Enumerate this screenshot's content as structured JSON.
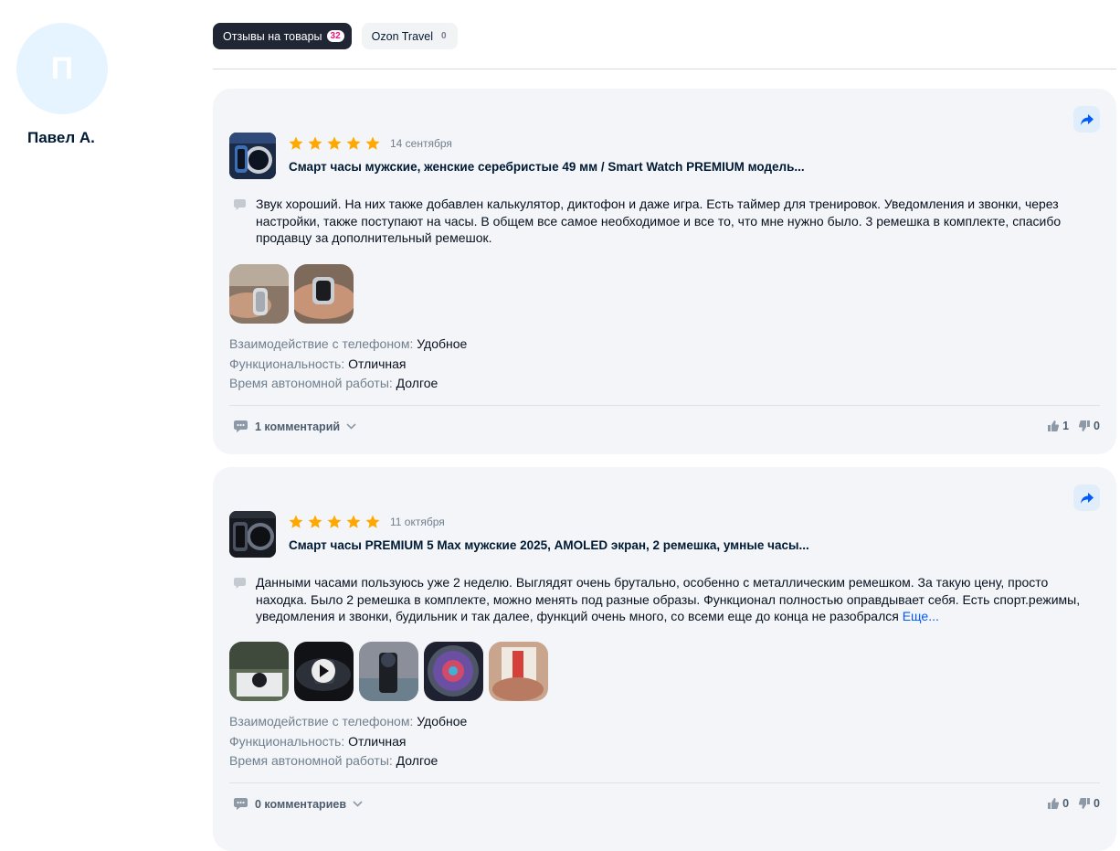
{
  "profile": {
    "initial": "П",
    "name": "Павел А."
  },
  "tabs": [
    {
      "label": "Отзывы на товары",
      "count": "32",
      "active": true
    },
    {
      "label": "Ozon Travel",
      "count": "0",
      "active": false
    }
  ],
  "colors": {
    "star": "#ffa800",
    "accent": "#005bff",
    "badge": "#f1117e"
  },
  "reviews": [
    {
      "rating": 5,
      "date": "14 сентября",
      "product_title": "Смарт часы мужские, женские серебристые 49 мм / Smart Watch PREMIUM модель...",
      "text": "Звук хороший. На них также добавлен калькулятор, диктофон и даже игра. Есть таймер для тренировок. Уведомления и звонки, через настройки, также поступают на часы. В общем все самое необходимое и все то, что мне нужно было. 3 ремешка в комплекте, спасибо продавцу за дополнительный ремешок.",
      "more_label": "",
      "photos": [
        "photo",
        "photo"
      ],
      "attributes": [
        {
          "label": "Взаимодействие с телефоном:",
          "value": "Удобное"
        },
        {
          "label": "Функциональность:",
          "value": "Отличная"
        },
        {
          "label": "Время автономной работы:",
          "value": "Долгое"
        }
      ],
      "comments_label": "1 комментарий",
      "likes": "1",
      "dislikes": "0"
    },
    {
      "rating": 5,
      "date": "11 октября",
      "product_title": "Смарт часы PREMIUM 5 Max мужские 2025, AMOLED экран, 2 ремешка, умные часы...",
      "text": "Данными часами пользуюсь уже 2 неделю. Выглядят очень брутально, особенно с металлическим ремешком. За такую цену, просто находка. Было 2 ремешка в комплекте, можно менять под разные образы. Функционал полностью оправдывает себя. Есть спорт.режимы, уведомления и звонки, будильник и так далее, функций очень много, со всеми еще до конца не разобрался",
      "more_label": "Еще...",
      "photos": [
        "photo",
        "video",
        "photo",
        "photo",
        "photo"
      ],
      "attributes": [
        {
          "label": "Взаимодействие с телефоном:",
          "value": "Удобное"
        },
        {
          "label": "Функциональность:",
          "value": "Отличная"
        },
        {
          "label": "Время автономной работы:",
          "value": "Долгое"
        }
      ],
      "comments_label": "0 комментариев",
      "likes": "0",
      "dislikes": "0"
    }
  ]
}
